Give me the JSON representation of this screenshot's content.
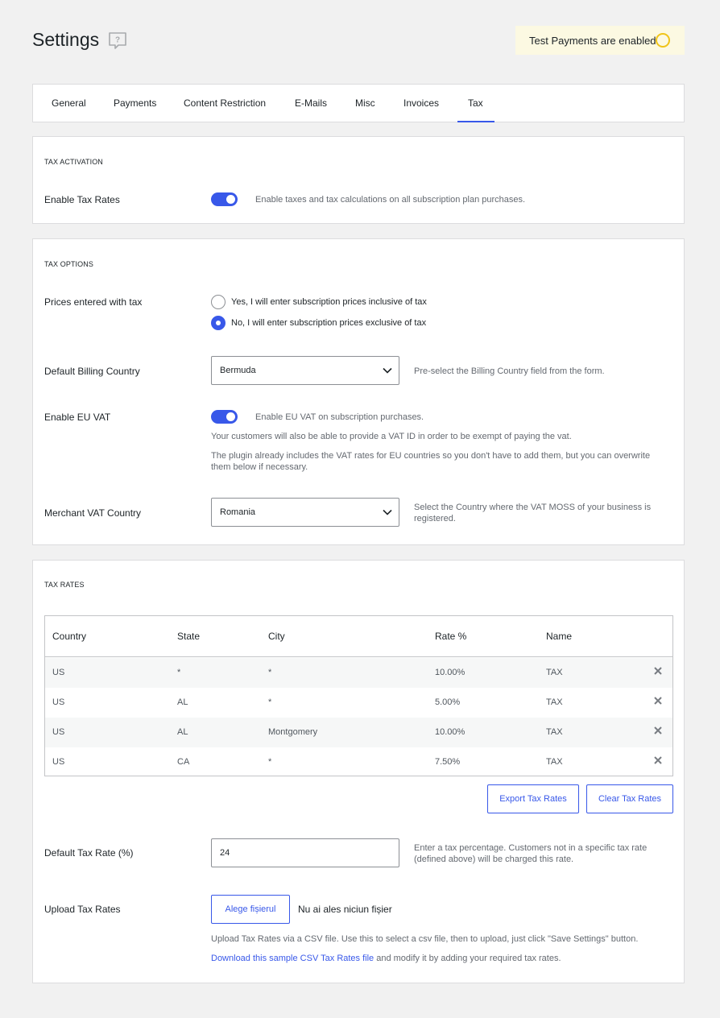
{
  "page": {
    "title": "Settings"
  },
  "notice": {
    "text": "Test Payments are enabled",
    "color": "#f0c419"
  },
  "tabs": [
    {
      "label": "General"
    },
    {
      "label": "Payments"
    },
    {
      "label": "Content Restriction"
    },
    {
      "label": "E-Mails"
    },
    {
      "label": "Misc"
    },
    {
      "label": "Invoices"
    },
    {
      "label": "Tax",
      "active": true
    }
  ],
  "tax_activation": {
    "title": "TAX ACTIVATION",
    "enable_label": "Enable Tax Rates",
    "enable_desc": "Enable taxes and tax calculations on all subscription plan purchases.",
    "enabled": true
  },
  "tax_options": {
    "title": "TAX OPTIONS",
    "prices_label": "Prices entered with tax",
    "radio_yes": "Yes, I will enter subscription prices inclusive of tax",
    "radio_no": "No, I will enter subscription prices exclusive of tax",
    "billing_label": "Default Billing Country",
    "billing_value": "Bermuda",
    "billing_desc": "Pre-select the Billing Country field from the form.",
    "eu_vat_label": "Enable EU VAT",
    "eu_vat_desc": "Enable EU VAT on subscription purchases.",
    "eu_vat_note1": "Your customers will also be able to provide a VAT ID in order to be exempt of paying the vat.",
    "eu_vat_note2": "The plugin already includes the VAT rates for EU countries so you don't have to add them, but you can overwrite them below if necessary.",
    "merchant_label": "Merchant VAT Country",
    "merchant_value": "Romania",
    "merchant_desc": "Select the Country where the VAT MOSS of your business is registered."
  },
  "tax_rates": {
    "title": "TAX RATES",
    "headers": {
      "country": "Country",
      "state": "State",
      "city": "City",
      "rate": "Rate %",
      "name": "Name"
    },
    "rows": [
      {
        "country": "US",
        "state": "*",
        "city": "*",
        "rate": "10.00%",
        "name": "TAX"
      },
      {
        "country": "US",
        "state": "AL",
        "city": "*",
        "rate": "5.00%",
        "name": "TAX"
      },
      {
        "country": "US",
        "state": "AL",
        "city": "Montgomery",
        "rate": "10.00%",
        "name": "TAX"
      },
      {
        "country": "US",
        "state": "CA",
        "city": "*",
        "rate": "7.50%",
        "name": "TAX"
      }
    ],
    "export_label": "Export Tax Rates",
    "clear_label": "Clear Tax Rates",
    "default_rate_label": "Default Tax Rate (%)",
    "default_rate_value": "24",
    "default_rate_desc": "Enter a tax percentage. Customers not in a specific tax rate (defined above) will be charged this rate.",
    "upload_label": "Upload Tax Rates",
    "file_button": "Alege fișierul",
    "file_status": "Nu ai ales niciun fișier",
    "upload_desc": "Upload Tax Rates via a CSV file. Use this to select a csv file, then to upload, just click \"Save Settings\" button.",
    "sample_link": "Download this sample CSV Tax Rates file",
    "sample_suffix": " and modify it by adding your required tax rates."
  }
}
